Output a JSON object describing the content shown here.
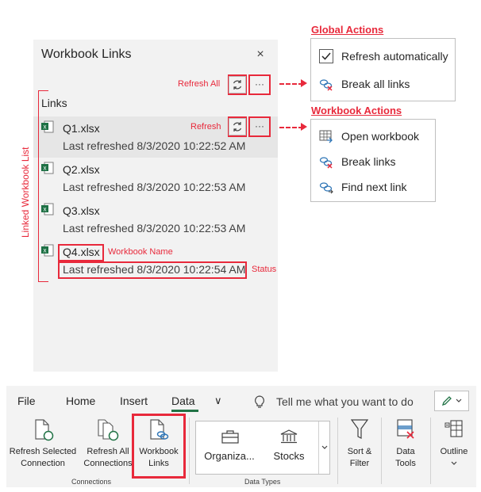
{
  "pane": {
    "title": "Workbook Links",
    "close_glyph": "×",
    "section_label": "Links",
    "files": [
      {
        "name": "Q1.xlsx",
        "status": "Last refreshed 8/3/2020 10:22:52 AM"
      },
      {
        "name": "Q2.xlsx",
        "status": "Last refreshed 8/3/2020 10:22:53 AM"
      },
      {
        "name": "Q3.xlsx",
        "status": "Last refreshed 8/3/2020 10:22:53 AM"
      },
      {
        "name": "Q4.xlsx",
        "status": "Last refreshed 8/3/2020 10:22:54 AM"
      }
    ],
    "more_glyph": "···"
  },
  "annotations": {
    "refresh_all": "Refresh All",
    "refresh": "Refresh",
    "linked_workbook_list": "Linked Workbook List",
    "workbook_name": "Workbook Name",
    "status": "Status"
  },
  "global_actions": {
    "title": "Global Actions",
    "items": [
      "Refresh automatically",
      "Break all links"
    ]
  },
  "workbook_actions": {
    "title": "Workbook Actions",
    "items": [
      "Open workbook",
      "Break links",
      "Find next link"
    ]
  },
  "ribbon": {
    "tabs": [
      "File",
      "Home",
      "Insert",
      "Data"
    ],
    "tab_chevron": "∨",
    "tell_me": "Tell me what you want to do",
    "buttons": {
      "refresh_selected": [
        "Refresh Selected",
        "Connection"
      ],
      "refresh_all": [
        "Refresh All",
        "Connections"
      ],
      "workbook_links": [
        "Workbook",
        "Links"
      ],
      "organization": "Organiza...",
      "stocks": "Stocks",
      "sort_filter": [
        "Sort &",
        "Filter"
      ],
      "data_tools": [
        "Data",
        "Tools"
      ],
      "outline": "Outline"
    },
    "groups": {
      "connections": "Connections",
      "data_types": "Data Types"
    }
  },
  "colors": {
    "accent": "#e8293b",
    "excel_green": "#1e7145",
    "link_blue": "#2e75b6"
  }
}
